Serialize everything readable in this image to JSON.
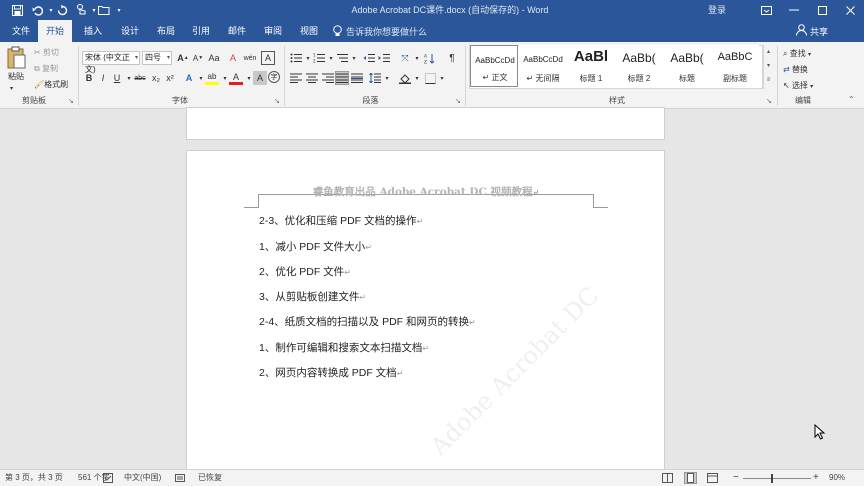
{
  "app": {
    "title": "Adobe Acrobat DC课件.docx (自动保存的)  -  Word",
    "signin": "登录",
    "share": "共享"
  },
  "quick_access": {
    "save_icon": "save-icon",
    "undo_icon": "undo-icon",
    "redo_icon": "redo-icon",
    "touch_icon": "touch-mode-icon",
    "open_icon": "folder-icon",
    "customize_icon": "chevron-down-icon"
  },
  "tabs": [
    "文件",
    "开始",
    "插入",
    "设计",
    "布局",
    "引用",
    "邮件",
    "审阅",
    "视图"
  ],
  "active_tab": "开始",
  "tell_me": "告诉我你想要做什么",
  "ribbon": {
    "clipboard": {
      "paste": "粘贴",
      "cut": "剪切",
      "copy": "复制",
      "format_painter": "格式刷",
      "label": "剪贴板"
    },
    "font": {
      "family": "宋体 (中文正文)",
      "size": "四号",
      "grow": "A",
      "shrink": "A",
      "case": "Aa",
      "clear": "A",
      "wen": "wén",
      "char_border": "A",
      "bold": "B",
      "italic": "I",
      "underline": "U",
      "strike": "abc",
      "subscript": "x₂",
      "superscript": "x²",
      "effects": "A",
      "highlight": "ab",
      "font_color": "A",
      "shading": "A",
      "enclose": "字",
      "label": "字体"
    },
    "paragraph": {
      "label": "段落"
    },
    "styles": {
      "items": [
        {
          "sample": "AaBbCcDd",
          "name": "↵ 正文"
        },
        {
          "sample": "AaBbCcDd",
          "name": "↵ 无间隔"
        },
        {
          "sample": "AaBl",
          "name": "标题 1"
        },
        {
          "sample": "AaBb(",
          "name": "标题 2"
        },
        {
          "sample": "AaBb(",
          "name": "标题"
        },
        {
          "sample": "AaBbC",
          "name": "副标题"
        }
      ],
      "label": "样式"
    },
    "editing": {
      "find": "查找",
      "replace": "替换",
      "select": "选择",
      "label": "编辑"
    }
  },
  "document": {
    "header_text": "睿鱼教育出品 Adobe Acrobat DC 视频教程",
    "watermark": "Adobe Acrobat DC",
    "lines": [
      "2-3、优化和压缩 PDF 文档的操作",
      "1、减小 PDF 文件大小",
      "2、优化 PDF 文件",
      "3、从剪贴板创建文件",
      "2-4、纸质文档的扫描以及 PDF 和网页的转换",
      "1、制作可编辑和搜索文本扫描文档",
      "2、网页内容转换成 PDF 文档"
    ],
    "paragraph_mark": "↵"
  },
  "status": {
    "page": "第 3 页，共 3 页",
    "words": "561 个字",
    "language": "中文(中国)",
    "recovered": "已恢复",
    "zoom": "90%"
  },
  "colors": {
    "brand": "#2b579a",
    "ribbon_bg": "#f3f3f3",
    "canvas_bg": "#e6e6e6",
    "highlight_yellow": "#ffff00",
    "font_red": "#e02020"
  }
}
